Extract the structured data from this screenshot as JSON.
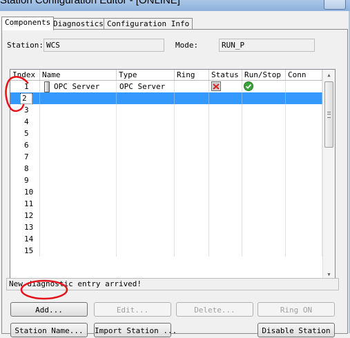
{
  "window": {
    "title": "Station Configuration Editor - [ONLINE]"
  },
  "tabs": [
    {
      "label": "Components"
    },
    {
      "label": "Diagnostics"
    },
    {
      "label": "Configuration Info"
    }
  ],
  "station": {
    "label": "Station:",
    "value": "WCS",
    "mode_label": "Mode:",
    "mode_value": "RUN_P"
  },
  "table": {
    "columns": [
      "Index",
      "Name",
      "Type",
      "Ring",
      "Status",
      "Run/Stop",
      "Conn"
    ],
    "rows": [
      {
        "index": "1",
        "name": "OPC Server",
        "type": "OPC Server",
        "status_icon": "status-warning-icon",
        "run_icon": "check-circle-icon"
      },
      {
        "index": "2",
        "selected": true
      },
      {
        "index": "3"
      },
      {
        "index": "4"
      },
      {
        "index": "5"
      },
      {
        "index": "6"
      },
      {
        "index": "7"
      },
      {
        "index": "8"
      },
      {
        "index": "9"
      },
      {
        "index": "10"
      },
      {
        "index": "11"
      },
      {
        "index": "12"
      },
      {
        "index": "13"
      },
      {
        "index": "14"
      },
      {
        "index": "15"
      }
    ]
  },
  "status_message": "New diagnostic entry arrived!",
  "buttons": {
    "add": "Add...",
    "edit": "Edit...",
    "delete": "Delete...",
    "ring_on": "Ring ON",
    "station_name": "Station Name...",
    "import_station": "Import Station ...",
    "disable_station": "Disable Station"
  },
  "colors": {
    "selection": "#3399ff",
    "annotation": "#e8111a",
    "check": "#3aa33a"
  }
}
